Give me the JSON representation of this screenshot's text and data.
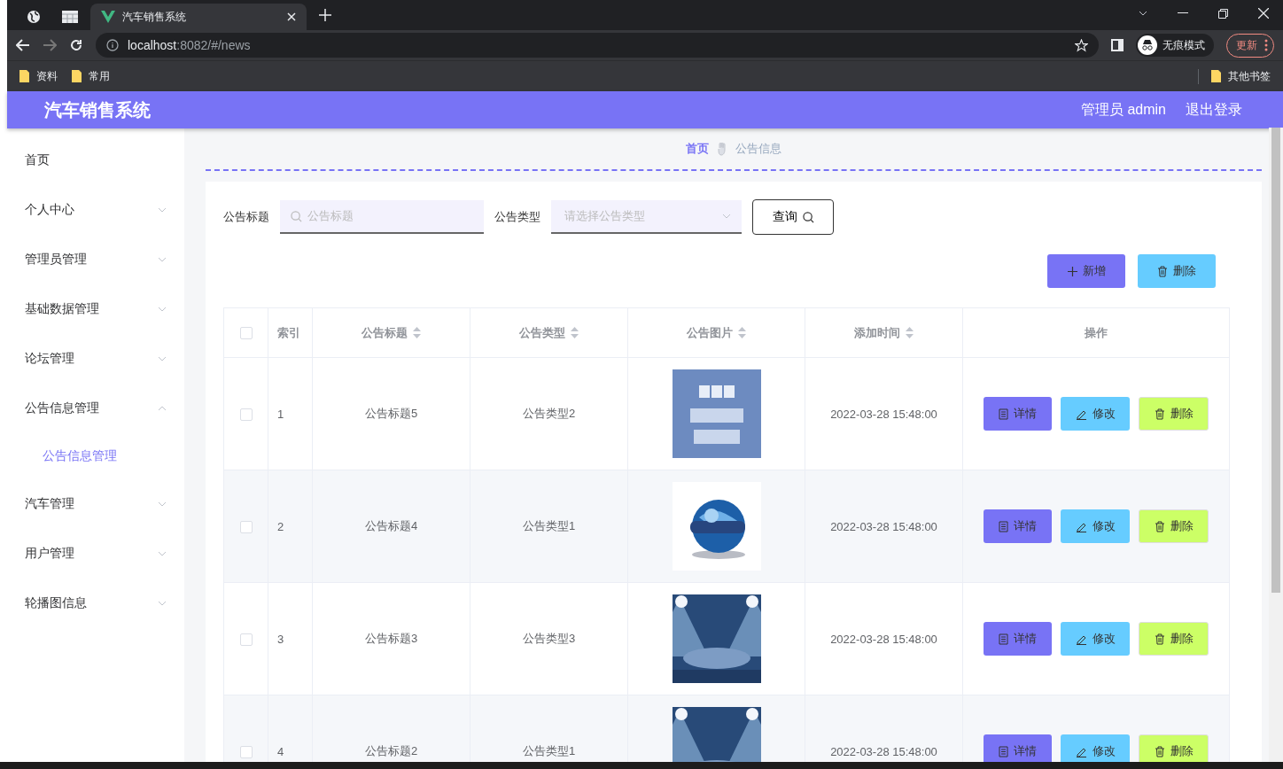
{
  "browser": {
    "tabs": [
      {
        "kind": "globe",
        "selected": false
      },
      {
        "kind": "sheet",
        "selected": false
      },
      {
        "kind": "page",
        "title": "汽车销售系统",
        "selected": true
      }
    ],
    "url_host": "localhost",
    "url_rest": ":8082/#/news",
    "incognito": "无痕模式",
    "update": "更新",
    "bookmarks": [
      "资料",
      "常用"
    ],
    "other_bookmarks": "其他书签"
  },
  "header": {
    "title": "汽车销售系统",
    "user": "管理员 admin",
    "logout": "退出登录"
  },
  "sidebar": {
    "items": [
      {
        "label": "首页",
        "kind": "link"
      },
      {
        "label": "个人中心",
        "kind": "submenu",
        "expanded": false
      },
      {
        "label": "管理员管理",
        "kind": "submenu",
        "expanded": false
      },
      {
        "label": "基础数据管理",
        "kind": "submenu",
        "expanded": false
      },
      {
        "label": "论坛管理",
        "kind": "submenu",
        "expanded": false
      },
      {
        "label": "公告信息管理",
        "kind": "submenu",
        "expanded": true,
        "children": [
          {
            "label": "公告信息管理",
            "selected": true
          }
        ]
      },
      {
        "label": "汽车管理",
        "kind": "submenu",
        "expanded": false
      },
      {
        "label": "用户管理",
        "kind": "submenu",
        "expanded": false
      },
      {
        "label": "轮播图信息",
        "kind": "submenu",
        "expanded": false
      }
    ]
  },
  "breadcrumb": [
    {
      "label": "首页",
      "kind": "link"
    },
    {
      "label": "公告信息",
      "kind": "current"
    }
  ],
  "filters": {
    "title_label": "公告标题",
    "title_placeholder": "公告标题",
    "type_label": "公告类型",
    "type_placeholder": "请选择公告类型",
    "search_button": "查询"
  },
  "toolbar": [
    {
      "label": "新增",
      "kind": "add"
    },
    {
      "label": "删除",
      "kind": "delete"
    }
  ],
  "table": {
    "all_checked": false,
    "columns": [
      {
        "label": "索引",
        "sortable": false
      },
      {
        "label": "公告标题",
        "sortable": true
      },
      {
        "label": "公告类型",
        "sortable": true
      },
      {
        "label": "公告图片",
        "sortable": true
      },
      {
        "label": "添加时间",
        "sortable": true
      },
      {
        "label": "操作",
        "sortable": false
      }
    ],
    "rows": [
      {
        "checked": false,
        "index": "1",
        "title": "公告标题5",
        "type": "公告类型2",
        "picture": {
          "kind": "picture"
        },
        "time": "2022-03-28 15:48:00",
        "actions": [
          {
            "label": "详情",
            "kind": "detail"
          },
          {
            "label": "修改",
            "kind": "edit"
          },
          {
            "label": "删除",
            "kind": "delete"
          }
        ]
      },
      {
        "checked": false,
        "index": "2",
        "title": "公告标题4",
        "type": "公告类型1",
        "picture": {
          "kind": "picture"
        },
        "time": "2022-03-28 15:48:00",
        "actions": [
          {
            "label": "详情",
            "kind": "detail"
          },
          {
            "label": "修改",
            "kind": "edit"
          },
          {
            "label": "删除",
            "kind": "delete"
          }
        ]
      },
      {
        "checked": false,
        "index": "3",
        "title": "公告标题3",
        "type": "公告类型3",
        "picture": {
          "kind": "picture"
        },
        "time": "2022-03-28 15:48:00",
        "actions": [
          {
            "label": "详情",
            "kind": "detail"
          },
          {
            "label": "修改",
            "kind": "edit"
          },
          {
            "label": "删除",
            "kind": "delete"
          }
        ]
      },
      {
        "checked": false,
        "index": "4",
        "title": "公告标题2",
        "type": "公告类型1",
        "picture": {
          "kind": "picture"
        },
        "time": "2022-03-28 15:48:00",
        "actions": [
          {
            "label": "详情",
            "kind": "detail"
          },
          {
            "label": "修改",
            "kind": "edit"
          },
          {
            "label": "删除",
            "kind": "delete"
          }
        ]
      }
    ]
  }
}
